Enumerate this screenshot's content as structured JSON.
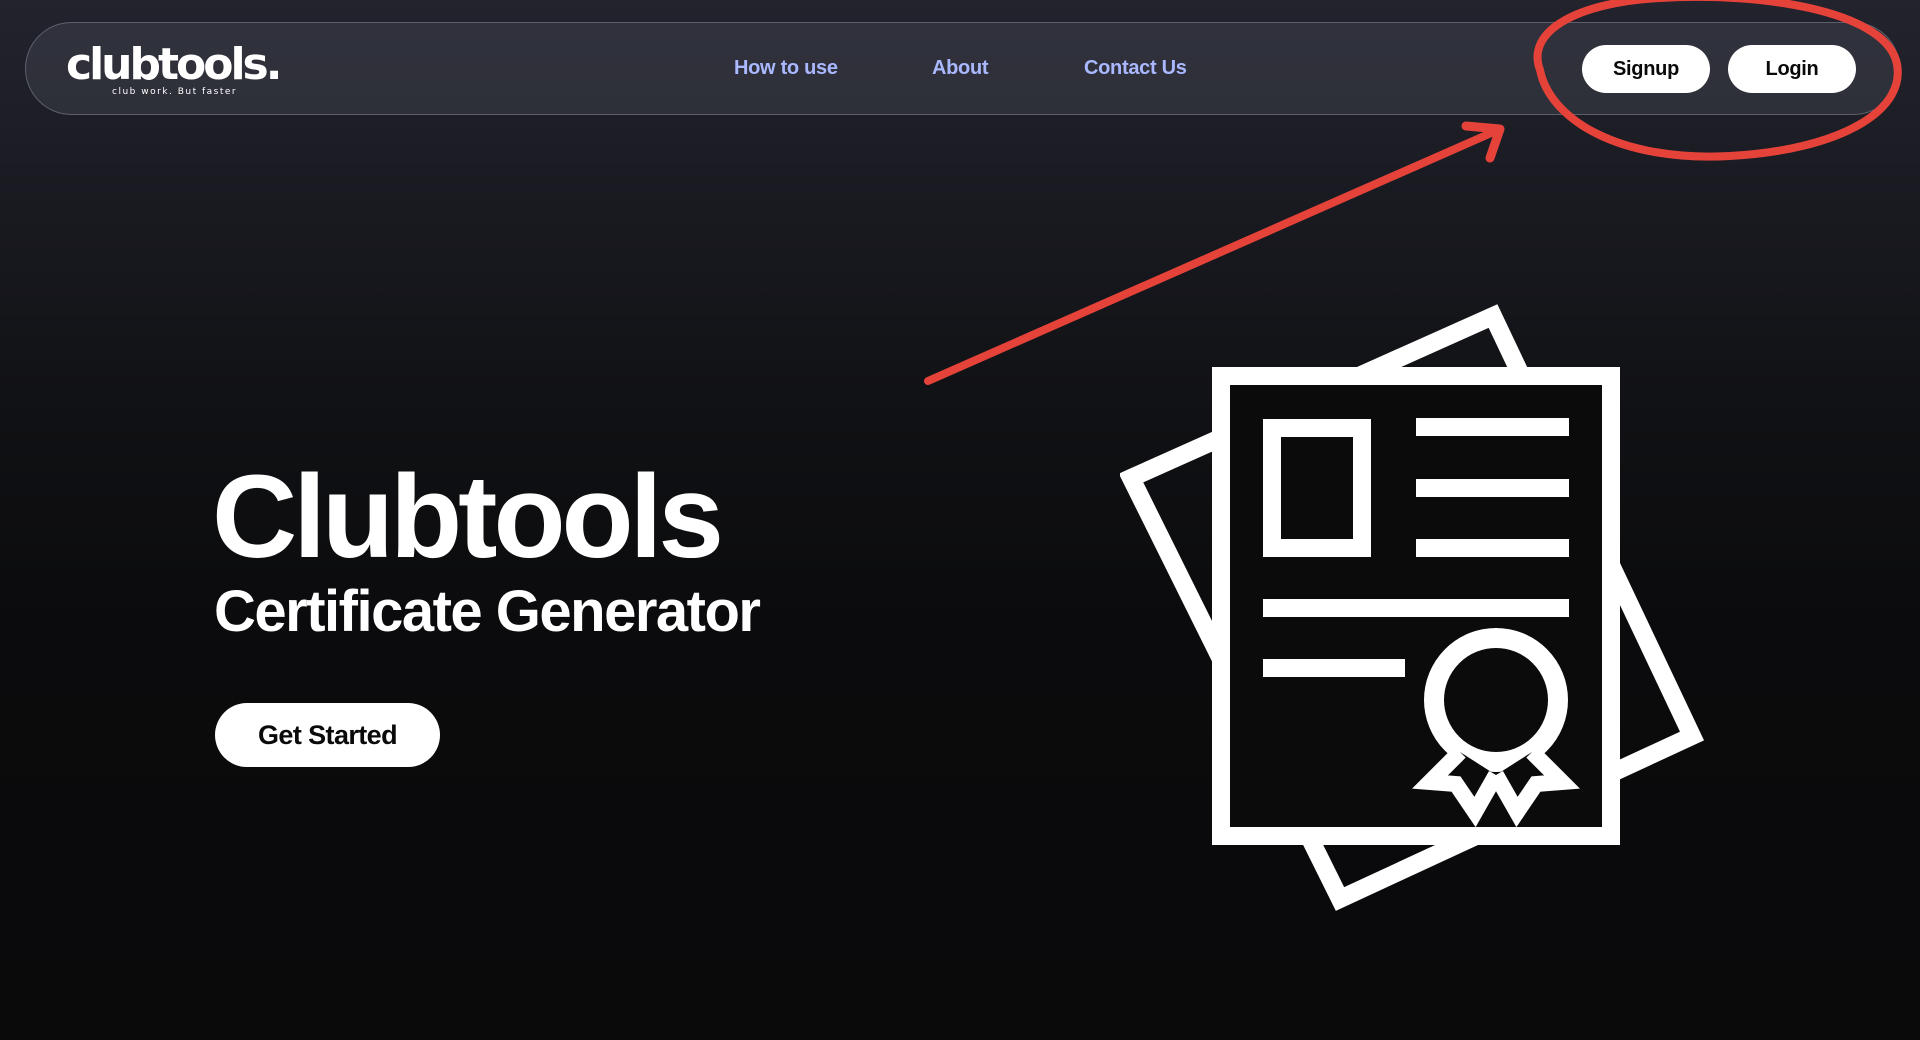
{
  "brand": {
    "logo_text": "clubtools.",
    "tagline": "club work. But faster"
  },
  "nav": {
    "links": [
      {
        "label": "How to use"
      },
      {
        "label": "About"
      },
      {
        "label": "Contact Us"
      }
    ],
    "signup_label": "Signup",
    "login_label": "Login"
  },
  "hero": {
    "title": "Clubtools",
    "subtitle": "Certificate Generator",
    "cta_label": "Get Started"
  },
  "illustration": {
    "icon": "certificate-icon"
  },
  "annotation": {
    "type": "red-arrow-and-ellipse",
    "target": "signup-and-login-buttons"
  },
  "colors": {
    "background": "#0a0a0b",
    "nav_link": "#a9b8ff",
    "button_bg": "#ffffff",
    "button_text": "#0a0a0a",
    "annotation": "#e5433a"
  }
}
